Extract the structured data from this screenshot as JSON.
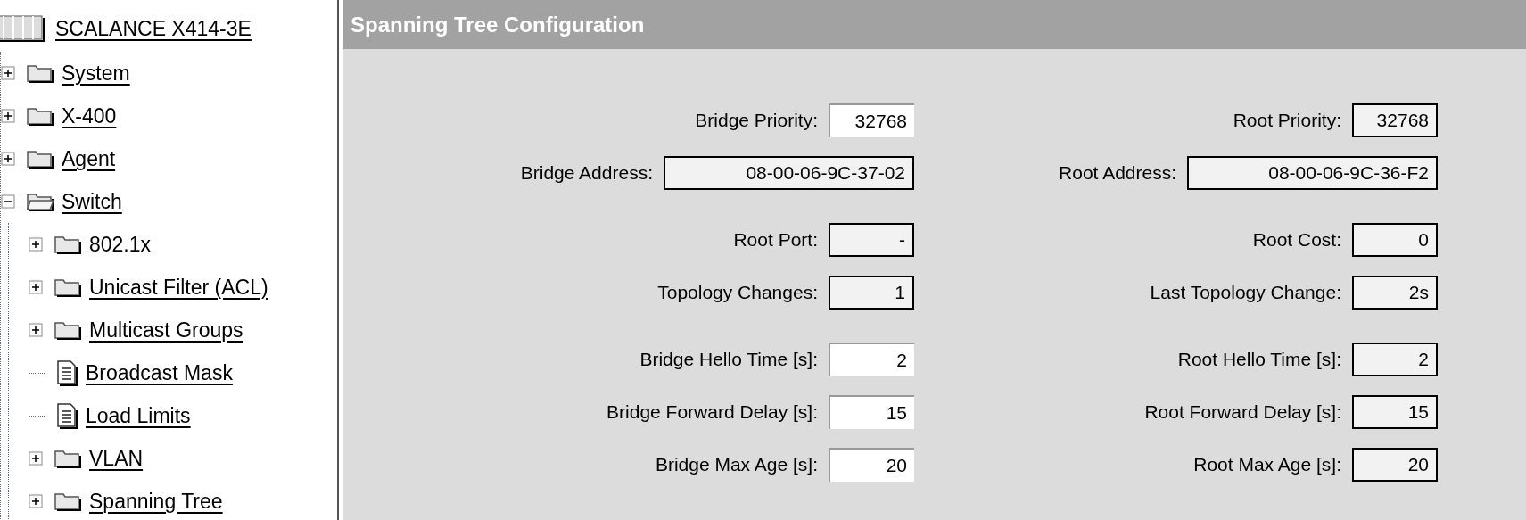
{
  "tree": {
    "root": {
      "label": "SCALANCE X414-3E"
    },
    "items": [
      {
        "label": "System",
        "kind": "folder",
        "expanded": false,
        "linked": true
      },
      {
        "label": "X-400",
        "kind": "folder",
        "expanded": false,
        "linked": true
      },
      {
        "label": "Agent",
        "kind": "folder",
        "expanded": false,
        "linked": true
      },
      {
        "label": "Switch",
        "kind": "folder",
        "expanded": true,
        "linked": true,
        "children": [
          {
            "label": "802.1x",
            "kind": "folder",
            "expanded": false,
            "linked": false
          },
          {
            "label": "Unicast Filter (ACL)",
            "kind": "folder",
            "expanded": false,
            "linked": true
          },
          {
            "label": "Multicast Groups",
            "kind": "folder",
            "expanded": false,
            "linked": true
          },
          {
            "label": "Broadcast Mask",
            "kind": "page",
            "linked": true
          },
          {
            "label": "Load Limits",
            "kind": "page",
            "linked": true
          },
          {
            "label": "VLAN",
            "kind": "folder",
            "expanded": false,
            "linked": true
          },
          {
            "label": "Spanning Tree",
            "kind": "folder",
            "expanded": false,
            "linked": true
          }
        ]
      }
    ]
  },
  "panel": {
    "title": "Spanning Tree Configuration",
    "sections": [
      {
        "rows": [
          {
            "left": {
              "label": "Bridge Priority:",
              "value": "32768",
              "kind": "number",
              "editable": true
            },
            "right": {
              "label": "Root Priority:",
              "value": "32768",
              "kind": "number",
              "editable": false
            }
          },
          {
            "left": {
              "label": "Bridge Address:",
              "value": "08-00-06-9C-37-02",
              "kind": "address",
              "editable": false
            },
            "right": {
              "label": "Root Address:",
              "value": "08-00-06-9C-36-F2",
              "kind": "address",
              "editable": false
            }
          }
        ]
      },
      {
        "rows": [
          {
            "left": {
              "label": "Root Port:",
              "value": "-",
              "kind": "number",
              "editable": false
            },
            "right": {
              "label": "Root Cost:",
              "value": "0",
              "kind": "number",
              "editable": false
            }
          },
          {
            "left": {
              "label": "Topology Changes:",
              "value": "1",
              "kind": "number",
              "editable": false
            },
            "right": {
              "label": "Last Topology Change:",
              "value": "2s",
              "kind": "number",
              "editable": false
            }
          }
        ]
      },
      {
        "rows": [
          {
            "left": {
              "label": "Bridge Hello Time [s]:",
              "value": "2",
              "kind": "number",
              "editable": true
            },
            "right": {
              "label": "Root Hello Time [s]:",
              "value": "2",
              "kind": "number",
              "editable": false
            }
          },
          {
            "left": {
              "label": "Bridge Forward Delay [s]:",
              "value": "15",
              "kind": "number",
              "editable": true
            },
            "right": {
              "label": "Root Forward Delay [s]:",
              "value": "15",
              "kind": "number",
              "editable": false
            }
          },
          {
            "left": {
              "label": "Bridge Max Age [s]:",
              "value": "20",
              "kind": "number",
              "editable": true
            },
            "right": {
              "label": "Root Max Age [s]:",
              "value": "20",
              "kind": "number",
              "editable": false
            }
          }
        ]
      }
    ]
  }
}
